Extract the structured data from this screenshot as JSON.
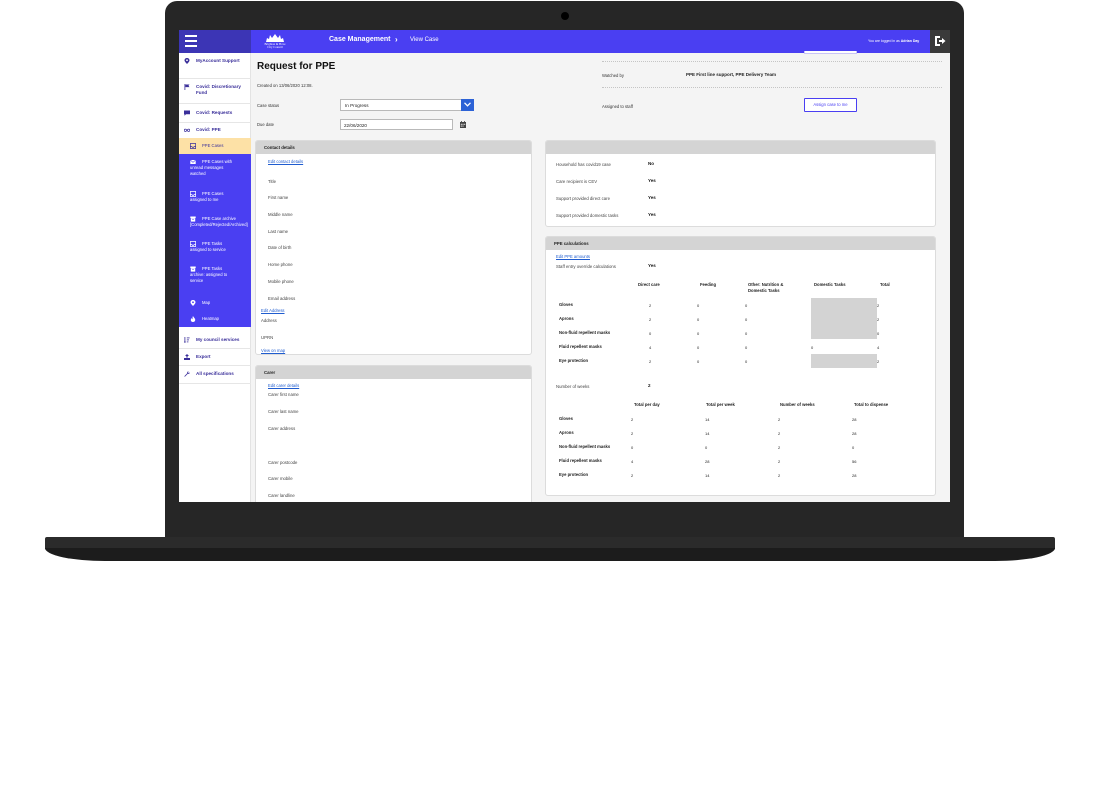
{
  "header": {
    "logo_lines": [
      "Brighton & Hove",
      "City Council"
    ],
    "breadcrumb": [
      "Case Management",
      "View Case"
    ],
    "breadcrumb_separator": "›",
    "logged_in_prefix": "You are logged in as",
    "logged_in_user": "Adrian Day",
    "accent_color": "#4a3ff2"
  },
  "sidebar": {
    "items": [
      {
        "label": "MyAccount Support",
        "icon": "location-pin-icon"
      },
      {
        "label": "Covid: Discretionary Fund",
        "icon": "flag-icon"
      },
      {
        "label": "Covid: Requests",
        "icon": "chat-icon"
      },
      {
        "label": "Covid: PPE",
        "icon": "glasses-icon"
      }
    ],
    "subitems": [
      {
        "lines": [
          "PPE Cases"
        ],
        "icon": "inbox-icon",
        "active": true
      },
      {
        "lines": [
          "PPE Cases with",
          "unread messages",
          "watched"
        ],
        "icon": "envelope-icon"
      },
      {
        "lines": [
          "PPE Cases",
          "assigned to me"
        ],
        "icon": "inbox-icon"
      },
      {
        "lines": [
          "PPE Case archive",
          "[Completed/Rejected/Archived]"
        ],
        "icon": "archive-icon"
      },
      {
        "lines": [
          "PPE Tasks",
          "assigned to service"
        ],
        "icon": "inbox-icon"
      },
      {
        "lines": [
          "PPE Tasks",
          "archive: assigned to",
          "service"
        ],
        "icon": "archive-icon"
      },
      {
        "lines": [
          "Map"
        ],
        "icon": "map-pin-icon"
      },
      {
        "lines": [
          "Heatmap"
        ],
        "icon": "fire-icon"
      }
    ],
    "bottom_items": [
      {
        "label": "My council services",
        "icon": "sort-icon"
      },
      {
        "label": "Export",
        "icon": "export-icon"
      },
      {
        "label": "All specifications",
        "icon": "wrench-icon"
      }
    ]
  },
  "page": {
    "title": "Request for PPE",
    "created": "Created on 13/06/2020 12:08.",
    "case_status_label": "Case status",
    "case_status_value": "In Progress",
    "due_date_label": "Due date",
    "due_date_value": "22/06/2020",
    "watched_by_label": "Watched by",
    "watched_by_value": "PPE First line support, PPE Delivery Team",
    "assigned_label": "Assigned to staff",
    "assign_button": "Assign case to me"
  },
  "contact": {
    "header": "Contact details",
    "edit_link": "Edit contact details",
    "fields": [
      "Title",
      "First name",
      "Middle name",
      "Last name",
      "Date of birth",
      "Home phone",
      "Mobile phone",
      "Email address"
    ],
    "edit_address_link": "Edit Address",
    "address_label": "Address",
    "uprn_label": "UPRN",
    "map_link": "View on map"
  },
  "carer": {
    "header": "Carer",
    "edit_link": "Edit carer details",
    "fields": [
      "Carer first name",
      "Carer last name",
      "Carer address",
      "Carer postcode",
      "Carer mobile",
      "Carer landline"
    ]
  },
  "household": {
    "rows": [
      {
        "label": "Household has covid19 case",
        "value": "No"
      },
      {
        "label": "Care recipient is CEV",
        "value": "Yes"
      },
      {
        "label": "Support provided direct care",
        "value": "Yes"
      },
      {
        "label": "Support provided domestic tasks",
        "value": "Yes"
      }
    ]
  },
  "ppe": {
    "header": "PPE calculations",
    "edit_link": "Edit PPE amounts",
    "override_label": "Staff entry override calculations",
    "override_value": "Yes",
    "table1": {
      "columns": [
        "Direct care",
        "Feeding",
        "Other: Nutrition & Domestic Tasks",
        "Domestic Tasks",
        "Total"
      ],
      "rows": [
        {
          "label": "Gloves",
          "values": [
            "2",
            "0",
            "0",
            "",
            "2"
          ]
        },
        {
          "label": "Aprons",
          "values": [
            "2",
            "0",
            "0",
            "",
            "2"
          ]
        },
        {
          "label": "Non-fluid repellent masks",
          "values": [
            "0",
            "0",
            "0",
            "",
            "0"
          ]
        },
        {
          "label": "Fluid repellent masks",
          "values": [
            "4",
            "0",
            "0",
            "0",
            "4"
          ]
        },
        {
          "label": "Eye protection",
          "values": [
            "2",
            "0",
            "0",
            "",
            "2"
          ]
        }
      ]
    },
    "weeks_label": "Number of weeks",
    "weeks_value": "2",
    "table2": {
      "columns": [
        "Total per day",
        "Total per week",
        "Number of weeks",
        "Total to dispense"
      ],
      "rows": [
        {
          "label": "Gloves",
          "values": [
            "2",
            "14",
            "2",
            "28"
          ]
        },
        {
          "label": "Aprons",
          "values": [
            "2",
            "14",
            "2",
            "28"
          ]
        },
        {
          "label": "Non-fluid repellent masks",
          "values": [
            "0",
            "0",
            "2",
            "0"
          ]
        },
        {
          "label": "Fluid repellent masks",
          "values": [
            "4",
            "28",
            "2",
            "56"
          ]
        },
        {
          "label": "Eye protection",
          "values": [
            "2",
            "14",
            "2",
            "28"
          ]
        }
      ]
    }
  }
}
